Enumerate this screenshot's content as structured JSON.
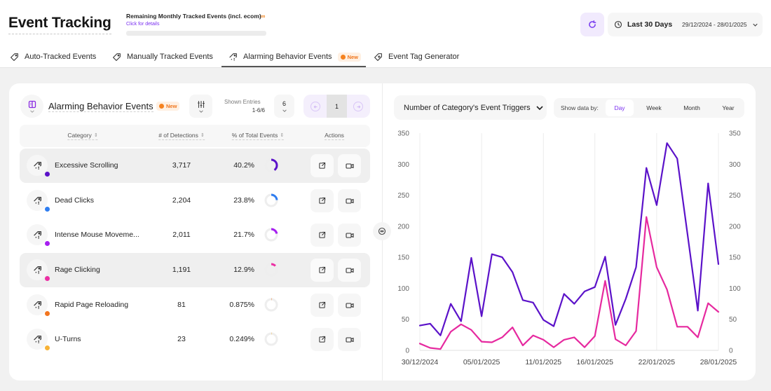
{
  "header": {
    "title": "Event Tracking",
    "quota_label": "Remaining Monthly Tracked Events (incl. ecom)",
    "quota_badge": "∞",
    "quota_link": "Click for details",
    "date_preset": "Last 30 Days",
    "date_range": "29/12/2024 - 28/01/2025"
  },
  "tabs": [
    {
      "label": "Auto-Tracked Events",
      "icon": "tag-icon",
      "active": false
    },
    {
      "label": "Manually Tracked Events",
      "icon": "tag-icon",
      "active": false
    },
    {
      "label": "Alarming Behavior Events",
      "icon": "alarm-tag-icon",
      "badge": "New",
      "active": true
    },
    {
      "label": "Event Tag Generator",
      "icon": "tag-generator-icon",
      "active": false
    }
  ],
  "panel": {
    "title": "Alarming Behavior Events",
    "badge": "New",
    "shown_entries_label": "Shown Entries",
    "shown_entries_value": "1-6/6",
    "page_size": "6",
    "current_page": "1"
  },
  "table": {
    "columns": [
      "Category",
      "# of Detections",
      "% of Total Events",
      "Actions"
    ],
    "rows": [
      {
        "category": "Excessive Scrolling",
        "detections": "3,717",
        "percent": "40.2%",
        "percent_value": 40.2,
        "color": "#5b12c9",
        "highlighted": true
      },
      {
        "category": "Dead Clicks",
        "detections": "2,204",
        "percent": "23.8%",
        "percent_value": 23.8,
        "color": "#2f7df0",
        "highlighted": false
      },
      {
        "category": "Intense Mouse Moveme...",
        "detections": "2,011",
        "percent": "21.7%",
        "percent_value": 21.7,
        "color": "#a61ff0",
        "highlighted": false
      },
      {
        "category": "Rage Clicking",
        "detections": "1,191",
        "percent": "12.9%",
        "percent_value": 12.9,
        "color": "#ec2fa4",
        "highlighted": true
      },
      {
        "category": "Rapid Page Reloading",
        "detections": "81",
        "percent": "0.875%",
        "percent_value": 0.875,
        "color": "#f2751f",
        "highlighted": false
      },
      {
        "category": "U-Turns",
        "detections": "23",
        "percent": "0.249%",
        "percent_value": 0.249,
        "color": "#f7b236",
        "highlighted": false
      }
    ]
  },
  "chart_controls": {
    "metric": "Number of Category's Event Triggers",
    "show_by_label": "Show data by:",
    "options": [
      "Day",
      "Week",
      "Month",
      "Year"
    ],
    "selected": "Day",
    "accent": "#7a2ff0"
  },
  "chart_data": {
    "type": "line",
    "title": "Number of Category's Event Triggers",
    "xlabel": "",
    "ylabel": "",
    "ylim": [
      0,
      350
    ],
    "yticks": [
      0,
      50,
      100,
      150,
      200,
      250,
      300,
      350
    ],
    "y_axis_sides": "left-and-right",
    "grid": true,
    "legend": "none",
    "x": [
      "30/12/2024",
      "31/12/2024",
      "01/01/2025",
      "02/01/2025",
      "03/01/2025",
      "04/01/2025",
      "05/01/2025",
      "06/01/2025",
      "07/01/2025",
      "08/01/2025",
      "09/01/2025",
      "10/01/2025",
      "11/01/2025",
      "12/01/2025",
      "13/01/2025",
      "14/01/2025",
      "15/01/2025",
      "16/01/2025",
      "17/01/2025",
      "18/01/2025",
      "19/01/2025",
      "20/01/2025",
      "21/01/2025",
      "22/01/2025",
      "23/01/2025",
      "24/01/2025",
      "25/01/2025",
      "26/01/2025",
      "27/01/2025",
      "28/01/2025"
    ],
    "xticks": [
      "30/12/2024",
      "05/01/2025",
      "11/01/2025",
      "16/01/2025",
      "22/01/2025",
      "28/01/2025"
    ],
    "series": [
      {
        "name": "Excessive Scrolling",
        "color": "#5b12c9",
        "values": [
          40,
          43,
          24,
          75,
          47,
          149,
          55,
          155,
          150,
          126,
          81,
          77,
          49,
          39,
          91,
          75,
          95,
          102,
          151,
          41,
          83,
          134,
          294,
          234,
          334,
          309,
          187,
          64,
          269,
          139
        ]
      },
      {
        "name": "Rage Clicking",
        "color": "#e6299f",
        "values": [
          11,
          4,
          2,
          30,
          42,
          33,
          14,
          13,
          21,
          37,
          8,
          24,
          17,
          5,
          17,
          21,
          5,
          23,
          112,
          18,
          8,
          31,
          215,
          134,
          98,
          38,
          38,
          21,
          76,
          62
        ]
      }
    ]
  }
}
